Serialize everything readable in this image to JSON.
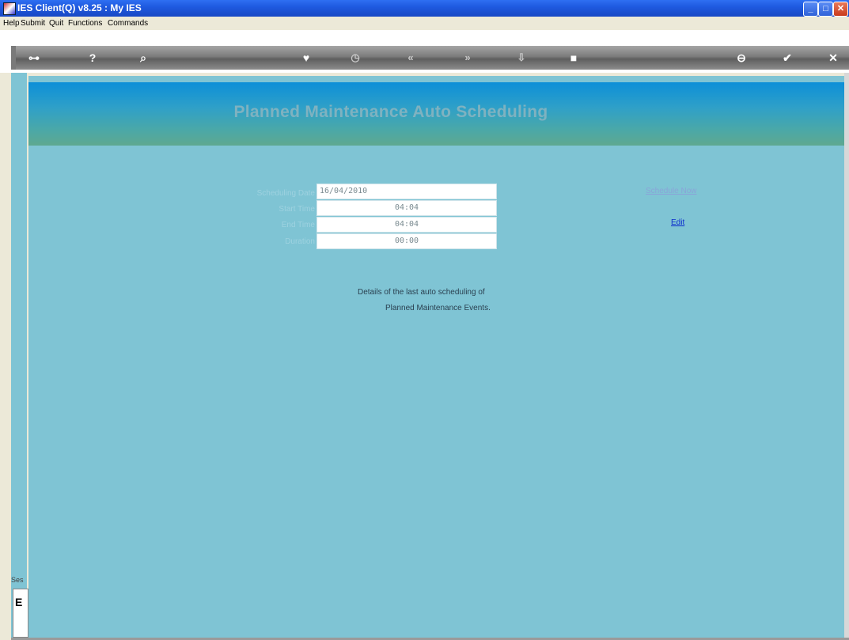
{
  "window": {
    "title": "IES Client(Q) v8.25 : My IES",
    "minimize_glyph": "_",
    "maximize_glyph": "□",
    "close_glyph": "✕"
  },
  "menu": {
    "items": [
      "Help",
      "Submit",
      "Quit",
      "Functions",
      "Commands"
    ]
  },
  "toolbar": {
    "icons": [
      {
        "name": "key-icon",
        "glyph": "⊶"
      },
      {
        "name": "help-icon",
        "glyph": "?"
      },
      {
        "name": "search-icon",
        "glyph": "⌕"
      },
      {
        "name": "heart-icon",
        "glyph": "♥"
      },
      {
        "name": "clock-icon",
        "glyph": "◷"
      },
      {
        "name": "previous-icon",
        "glyph": "«"
      },
      {
        "name": "next-icon",
        "glyph": "»"
      },
      {
        "name": "insert-icon",
        "glyph": "⇩"
      },
      {
        "name": "stop-icon",
        "glyph": "■"
      },
      {
        "name": "cancel-icon",
        "glyph": "⊖"
      },
      {
        "name": "ok-icon",
        "glyph": "✔"
      },
      {
        "name": "close-icon",
        "glyph": "✕"
      }
    ]
  },
  "banner": {
    "title": "Planned Maintenance Auto Scheduling"
  },
  "form": {
    "scheduling_date_label": "Scheduling Date",
    "scheduling_date_value": "16/04/2010",
    "start_time_label": "Start Time",
    "start_time_value": "04:04",
    "end_time_label": "End Time",
    "end_time_value": "04:04",
    "duration_label": "Duration",
    "duration_value": "00:00"
  },
  "actions": {
    "schedule_now": "Schedule Now",
    "edit": "Edit"
  },
  "info": {
    "line1": "Details of the last auto scheduling of",
    "line2": "Planned Maintenance Events."
  },
  "side": {
    "label": "Ses",
    "box_char": "E"
  }
}
